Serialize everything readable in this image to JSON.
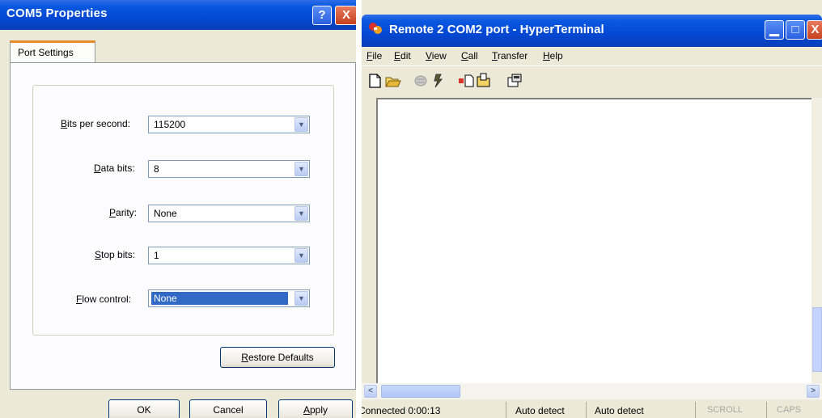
{
  "dialog": {
    "title": "COM5 Properties",
    "help_glyph": "?",
    "close_glyph": "X",
    "tab": "Port Settings",
    "fields": [
      {
        "label_u": "B",
        "label_rest": "its per second:",
        "value": "115200"
      },
      {
        "label_u": "D",
        "label_rest": "ata bits:",
        "value": "8"
      },
      {
        "label_pre": "",
        "label_u": "P",
        "label_rest": "arity:",
        "value": "None"
      },
      {
        "label_u": "S",
        "label_rest": "top bits:",
        "value": "1"
      },
      {
        "label_u": "F",
        "label_rest": "low control:",
        "value": "None"
      }
    ],
    "restore_u": "R",
    "restore_rest": "estore Defaults",
    "ok": "OK",
    "cancel": "Cancel",
    "apply_u": "A",
    "apply_rest": "pply"
  },
  "hyperterminal": {
    "title": "Remote 2 COM2 port - HyperTerminal",
    "menu": [
      {
        "u": "F",
        "rest": "ile"
      },
      {
        "u": "E",
        "rest": "dit"
      },
      {
        "u": "V",
        "rest": "iew"
      },
      {
        "u": "C",
        "rest": "all"
      },
      {
        "u": "T",
        "rest": "ransfer"
      },
      {
        "u": "H",
        "rest": "elp"
      }
    ],
    "toolbar_icons": [
      "new-icon",
      "open-icon",
      "disconnect-icon",
      "connect-icon",
      "send-icon",
      "receive-icon",
      "properties-icon"
    ],
    "status": {
      "connected": "Connected 0:00:13",
      "detect1": "Auto detect",
      "detect2": "Auto detect",
      "scroll": "SCROLL",
      "caps": "CAPS"
    },
    "colors": {
      "titlebar": "#0348d4",
      "selection": "#316ac5"
    }
  }
}
